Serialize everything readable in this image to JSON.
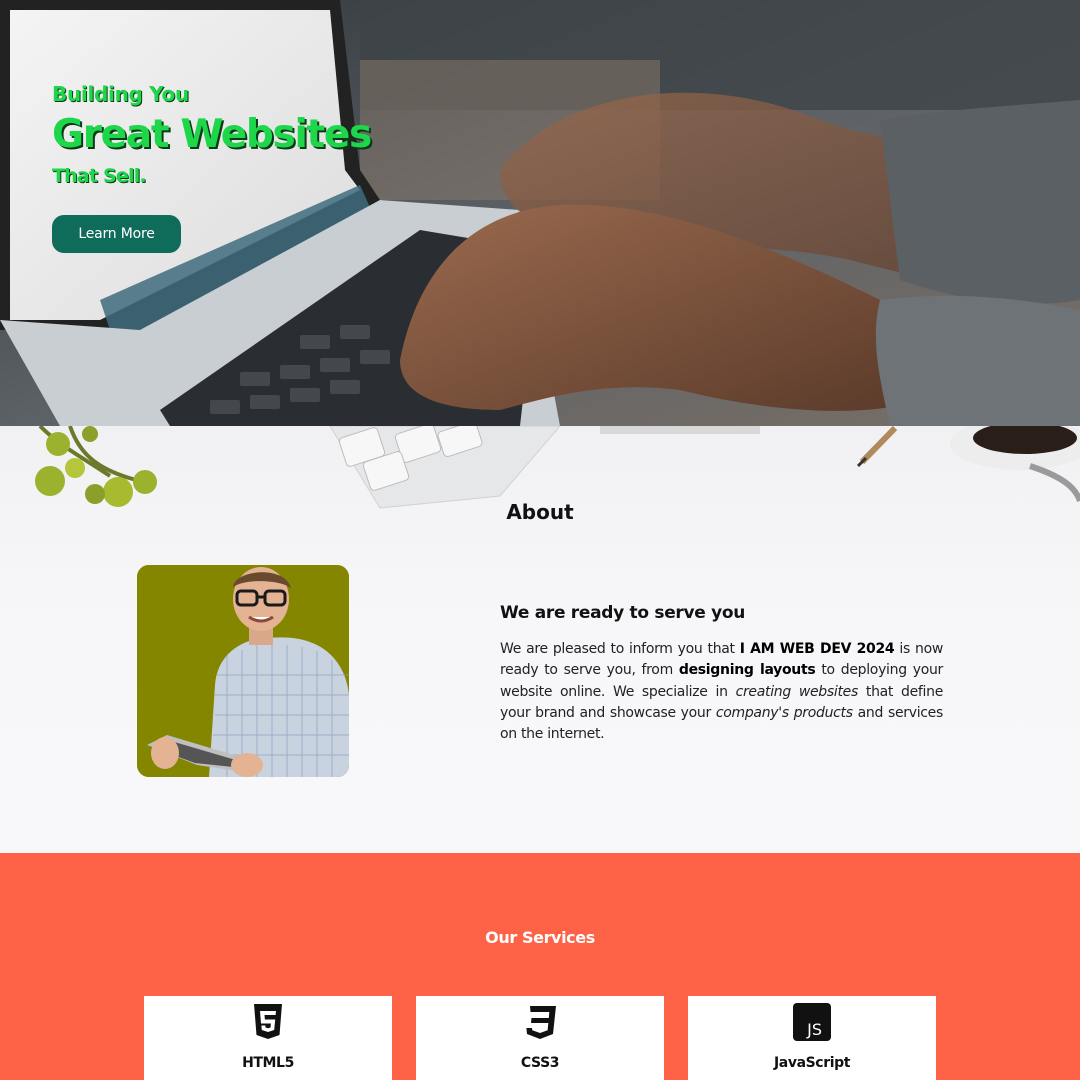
{
  "hero": {
    "line_1": "Building You",
    "line_2": "Great Websites",
    "line_3": "That Sell.",
    "cta_label": "Learn More"
  },
  "about": {
    "title": "About",
    "heading": "We are ready to serve you",
    "body": {
      "t1": "We are pleased to inform you that ",
      "b1": "I AM WEB DEV 2024",
      "t2": " is now ready to serve you, from ",
      "b2": "designing layouts",
      "t3": " to deploying your website online. We specialize in ",
      "i1": "creating websites",
      "t4": " that define your brand and showcase your ",
      "i2": "company's products",
      "t5": " and services on the internet."
    }
  },
  "services": {
    "title": "Our Services",
    "items": [
      {
        "label": "HTML5",
        "icon": "html5-icon"
      },
      {
        "label": "CSS3",
        "icon": "css3-icon"
      },
      {
        "label": "JavaScript",
        "icon": "javascript-icon",
        "badge": "JS"
      }
    ]
  },
  "colors": {
    "hero_text": "#1ed64a",
    "cta_bg": "#0f6b5a",
    "services_bg": "#ff6347",
    "photo_bg": "#858600"
  }
}
